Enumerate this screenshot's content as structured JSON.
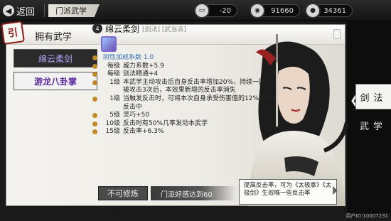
{
  "topbar": {
    "back_label": "返回",
    "breadcrumb": "门派武学",
    "resources": [
      {
        "icon": "ticket-icon",
        "value": "-20"
      },
      {
        "icon": "silver-icon",
        "value": "91660"
      },
      {
        "icon": "coin-icon",
        "value": "34361"
      }
    ]
  },
  "panel": {
    "seal_char": "引",
    "title": "拥有武学"
  },
  "skill_list": [
    {
      "label": "绵云柔剑",
      "active": true
    },
    {
      "label": "游龙八卦掌",
      "active": false
    }
  ],
  "detail": {
    "level_badge": "4",
    "name": "绵云柔剑",
    "tags": "[剑法] [武当派]",
    "rows": [
      {
        "dot": true,
        "req": "",
        "text": "阴性加成系数 1.0",
        "highlight": true
      },
      {
        "dot": true,
        "req": "每级",
        "text": "威力系数+5.9"
      },
      {
        "dot": true,
        "req": "每级",
        "text": "剑法精通+4"
      },
      {
        "dot": true,
        "req": "1级",
        "text": "本武学主动攻击后自身反击率增加20%，持续一回合，被攻击3次后，本效果新增的反击率消失"
      },
      {
        "dot": true,
        "req": "1级",
        "text": "当触发反击时，可将本次自身承受伤害值的12%附加到反击中"
      },
      {
        "dot": true,
        "req": "5级",
        "text": "灵巧+50"
      },
      {
        "dot": true,
        "req": "10级",
        "text": "反击时有50%几率发动本武学"
      },
      {
        "dot": true,
        "req": "15级",
        "text": "反击率+6.3%"
      }
    ]
  },
  "bottom": {
    "locked_label": "不可修炼",
    "condition": "门派好感达到60",
    "tip": "提高反击率，可为《太极拳》《太极剑》生效唯一些反击率"
  },
  "tabs": [
    {
      "label": "剑法",
      "active": true
    },
    {
      "label": "武学",
      "active": false
    }
  ],
  "footer_id": "用户ID:10007231",
  "colors": {
    "accent_purple": "#5b2a9c",
    "highlight_blue": "#2d6fb8",
    "dot_gold": "#c08a2a"
  }
}
